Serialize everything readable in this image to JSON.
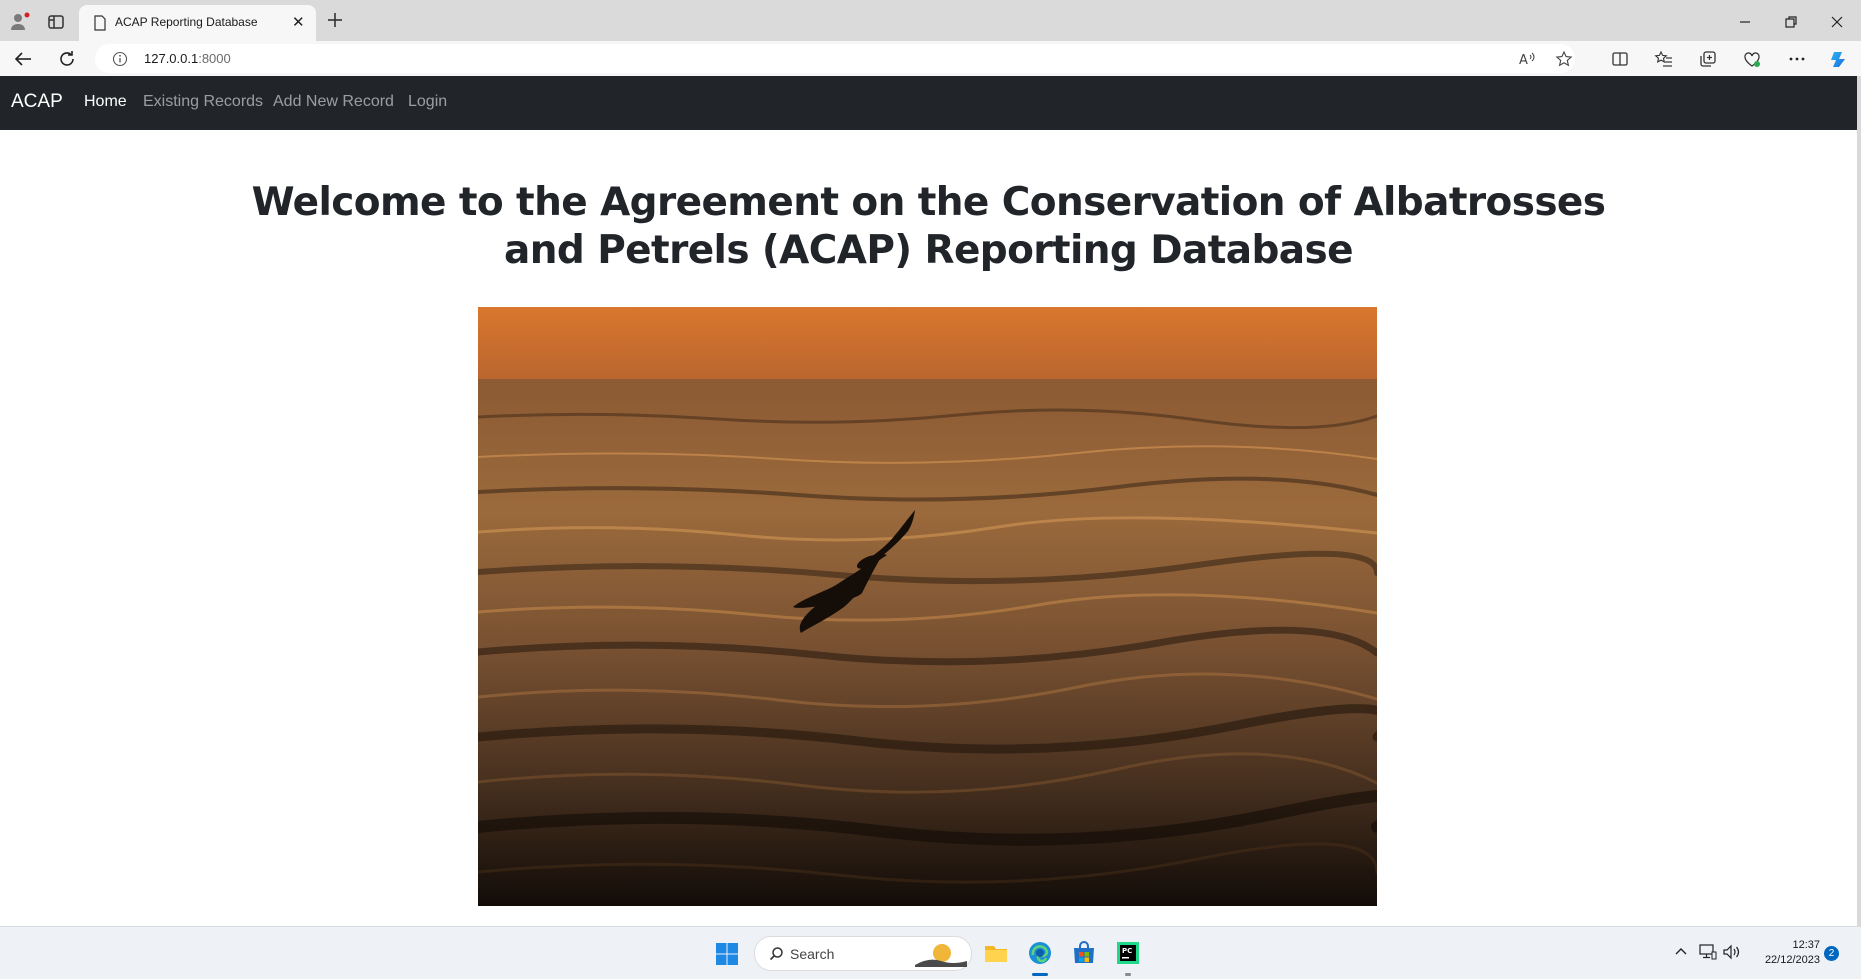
{
  "browser": {
    "tab": {
      "title": "ACAP Reporting Database",
      "close_glyph": "✕"
    },
    "address": {
      "host": "127.0.0.1",
      "port": ":8000"
    }
  },
  "navbar": {
    "brand": "ACAP",
    "links": [
      {
        "label": "Home",
        "active": true
      },
      {
        "label": "Existing Records",
        "active": false
      },
      {
        "label": "Add New Record",
        "active": false
      },
      {
        "label": "Login",
        "active": false
      }
    ]
  },
  "main": {
    "heading": "Welcome to the Agreement on the Conservation of Albatrosses and Petrels (ACAP) Reporting Database"
  },
  "taskbar": {
    "search_label": "Search",
    "clock": {
      "time": "12:37",
      "date": "22/12/2023"
    },
    "notification_count": "2"
  },
  "colors": {
    "navbar_bg": "#212529",
    "accent": "#0067c0",
    "sunset_orange": "#d9772e"
  }
}
